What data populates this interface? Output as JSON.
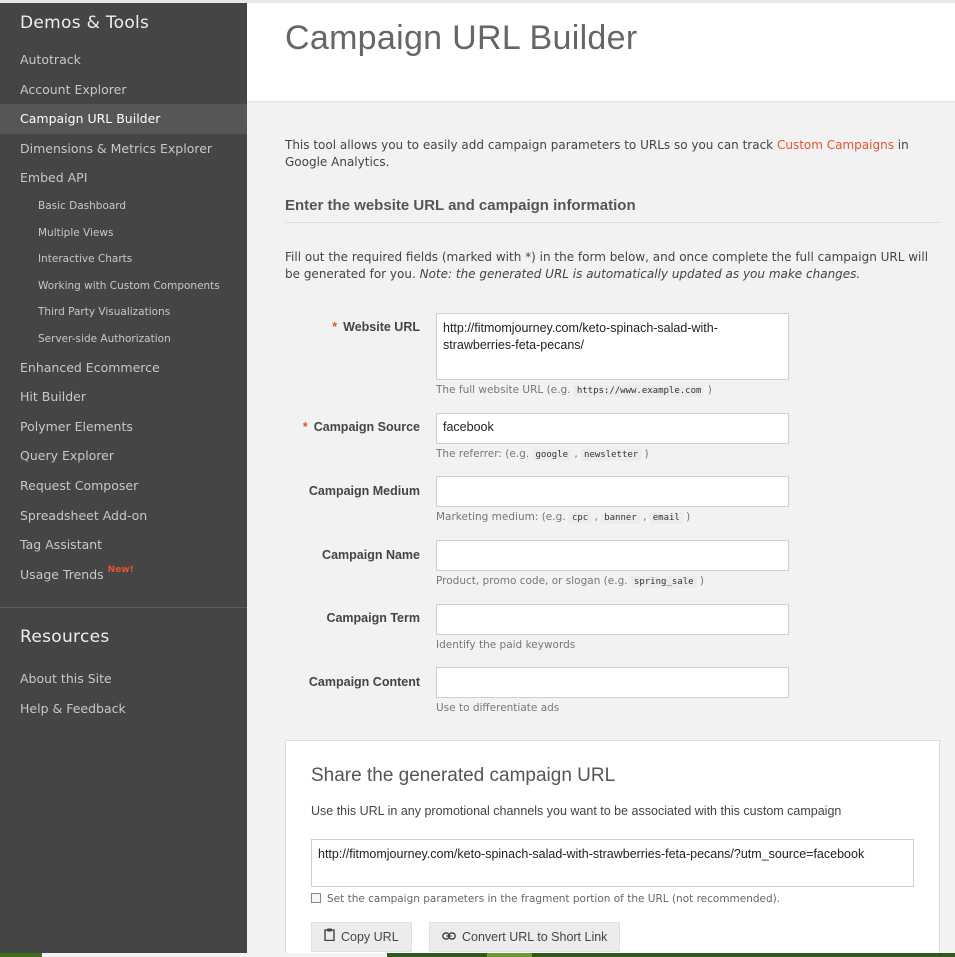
{
  "sidebar": {
    "header": "Demos & Tools",
    "items": [
      {
        "label": "Autotrack"
      },
      {
        "label": "Account Explorer"
      },
      {
        "label": "Campaign URL Builder"
      },
      {
        "label": "Dimensions & Metrics Explorer"
      },
      {
        "label": "Embed API"
      }
    ],
    "sub_items": [
      {
        "label": "Basic Dashboard"
      },
      {
        "label": "Multiple Views"
      },
      {
        "label": "Interactive Charts"
      },
      {
        "label": "Working with Custom Components"
      },
      {
        "label": "Third Party Visualizations"
      },
      {
        "label": "Server-side Authorization"
      }
    ],
    "items2": [
      {
        "label": "Enhanced Ecommerce"
      },
      {
        "label": "Hit Builder"
      },
      {
        "label": "Polymer Elements"
      },
      {
        "label": "Query Explorer"
      },
      {
        "label": "Request Composer"
      },
      {
        "label": "Spreadsheet Add-on"
      },
      {
        "label": "Tag Assistant"
      },
      {
        "label": "Usage Trends",
        "badge": "New!"
      }
    ],
    "resources_header": "Resources",
    "resources": [
      {
        "label": "About this Site"
      },
      {
        "label": "Help & Feedback"
      }
    ]
  },
  "header": {
    "title": "Campaign URL Builder"
  },
  "intro": {
    "before": "This tool allows you to easily add campaign parameters to URLs so you can track ",
    "link": "Custom Campaigns",
    "after": " in Google Analytics."
  },
  "section_title": "Enter the website URL and campaign information",
  "desc": {
    "text": "Fill out the required fields (marked with *) in the form below, and once complete the full campaign URL will be generated for you. ",
    "note": "Note: the generated URL is automatically updated as you make changes."
  },
  "form": {
    "required_mark": "*",
    "website_url": {
      "label": "Website URL",
      "value": "http://fitmomjourney.com/keto-spinach-salad-with-strawberries-feta-pecans/",
      "hint_before": "The full website URL (e.g. ",
      "hint_code": "https://www.example.com",
      "hint_after": " )"
    },
    "source": {
      "label": "Campaign Source",
      "value": "facebook",
      "hint_before": "The referrer: (e.g. ",
      "code1": "google",
      "sep": " , ",
      "code2": "newsletter",
      "hint_after": " )"
    },
    "medium": {
      "label": "Campaign Medium",
      "value": "",
      "hint_before": "Marketing medium: (e.g. ",
      "code1": "cpc",
      "code2": "banner",
      "code3": "email",
      "hint_after": " )"
    },
    "name": {
      "label": "Campaign Name",
      "value": "",
      "hint_before": "Product, promo code, or slogan (e.g. ",
      "code1": "spring_sale",
      "hint_after": " )"
    },
    "term": {
      "label": "Campaign Term",
      "value": "",
      "hint": "Identify the paid keywords"
    },
    "content": {
      "label": "Campaign Content",
      "value": "",
      "hint": "Use to differentiate ads"
    }
  },
  "share": {
    "title": "Share the generated campaign URL",
    "desc": "Use this URL in any promotional channels you want to be associated with this custom campaign",
    "url": "http://fitmomjourney.com/keto-spinach-salad-with-strawberries-feta-pecans/?utm_source=facebook",
    "checkbox_label": "Set the campaign parameters in the fragment portion of the URL (not recommended).",
    "copy_label": "Copy URL",
    "short_label": "Convert URL to Short Link"
  },
  "colors": {
    "accent": "#e8532f",
    "sidebar_bg": "#454545",
    "sidebar_active": "#565656"
  }
}
